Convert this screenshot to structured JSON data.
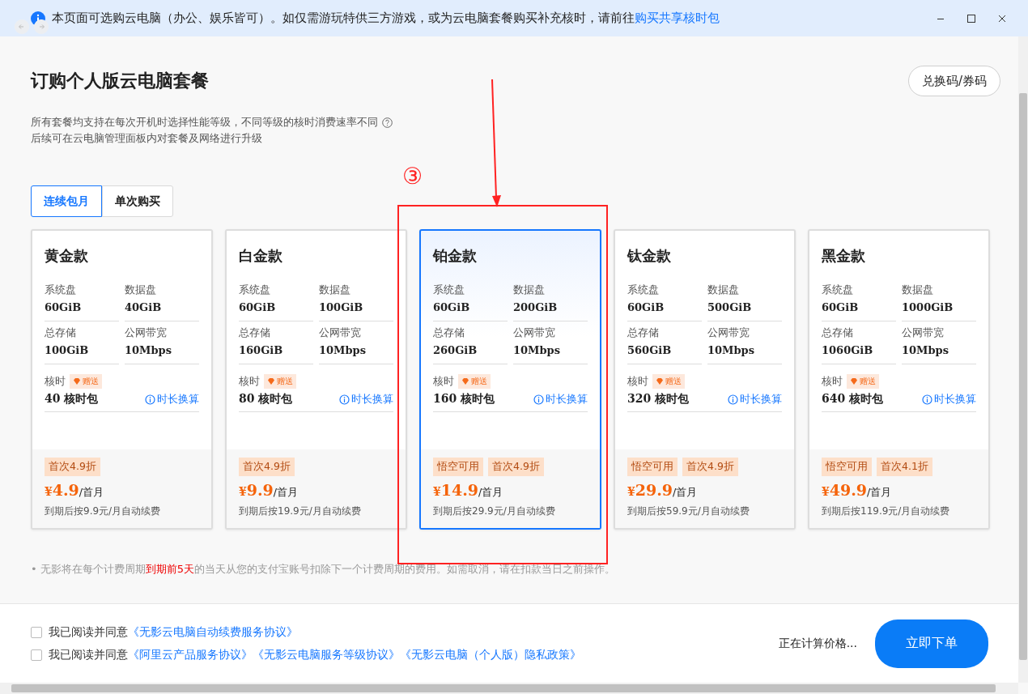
{
  "banner": {
    "text": "本页面可选购云电脑（办公、娱乐皆可）。如仅需游玩特供三方游戏，或为云电脑套餐购买补充核时，请前往",
    "link": "购买共享核时包"
  },
  "title": "订购个人版云电脑套餐",
  "redeem_button": "兑换码/券码",
  "notes": [
    "所有套餐均支持在每次开机时选择性能等级，不同等级的核时消费速率不同",
    "后续可在云电脑管理面板内对套餐及网络进行升级"
  ],
  "tabs": [
    {
      "label": "连续包月",
      "selected": true
    },
    {
      "label": "单次购买",
      "selected": false
    }
  ],
  "plans": [
    {
      "name": "黄金款",
      "selected": false,
      "specs": [
        {
          "label": "系统盘",
          "value": "60GiB"
        },
        {
          "label": "数据盘",
          "value": "40GiB"
        },
        {
          "label": "总存储",
          "value": "100GiB"
        },
        {
          "label": "公网带宽",
          "value": "10Mbps"
        }
      ],
      "core_label": "核时",
      "gift": "赠送",
      "core_value": "40 核时包",
      "convert": "时长换算",
      "tags": [
        "首次4.9折"
      ],
      "currency": "¥",
      "price": "4.9",
      "unit": "/首月",
      "renewal": "到期后按9.9元/月自动续费"
    },
    {
      "name": "白金款",
      "selected": false,
      "specs": [
        {
          "label": "系统盘",
          "value": "60GiB"
        },
        {
          "label": "数据盘",
          "value": "100GiB"
        },
        {
          "label": "总存储",
          "value": "160GiB"
        },
        {
          "label": "公网带宽",
          "value": "10Mbps"
        }
      ],
      "core_label": "核时",
      "gift": "赠送",
      "core_value": "80 核时包",
      "convert": "时长换算",
      "tags": [
        "首次4.9折"
      ],
      "currency": "¥",
      "price": "9.9",
      "unit": "/首月",
      "renewal": "到期后按19.9元/月自动续费"
    },
    {
      "name": "铂金款",
      "selected": true,
      "specs": [
        {
          "label": "系统盘",
          "value": "60GiB"
        },
        {
          "label": "数据盘",
          "value": "200GiB"
        },
        {
          "label": "总存储",
          "value": "260GiB"
        },
        {
          "label": "公网带宽",
          "value": "10Mbps"
        }
      ],
      "core_label": "核时",
      "gift": "赠送",
      "core_value": "160 核时包",
      "convert": "时长换算",
      "tags": [
        "悟空可用",
        "首次4.9折"
      ],
      "currency": "¥",
      "price": "14.9",
      "unit": "/首月",
      "renewal": "到期后按29.9元/月自动续费"
    },
    {
      "name": "钛金款",
      "selected": false,
      "specs": [
        {
          "label": "系统盘",
          "value": "60GiB"
        },
        {
          "label": "数据盘",
          "value": "500GiB"
        },
        {
          "label": "总存储",
          "value": "560GiB"
        },
        {
          "label": "公网带宽",
          "value": "10Mbps"
        }
      ],
      "core_label": "核时",
      "gift": "赠送",
      "core_value": "320 核时包",
      "convert": "时长换算",
      "tags": [
        "悟空可用",
        "首次4.9折"
      ],
      "currency": "¥",
      "price": "29.9",
      "unit": "/首月",
      "renewal": "到期后按59.9元/月自动续费"
    },
    {
      "name": "黑金款",
      "selected": false,
      "specs": [
        {
          "label": "系统盘",
          "value": "60GiB"
        },
        {
          "label": "数据盘",
          "value": "1000GiB"
        },
        {
          "label": "总存储",
          "value": "1060GiB"
        },
        {
          "label": "公网带宽",
          "value": "10Mbps"
        }
      ],
      "core_label": "核时",
      "gift": "赠送",
      "core_value": "640 核时包",
      "convert": "时长换算",
      "tags": [
        "悟空可用",
        "首次4.1折"
      ],
      "currency": "¥",
      "price": "49.9",
      "unit": "/首月",
      "renewal": "到期后按119.9元/月自动续费"
    }
  ],
  "disclaimer": {
    "bullet": "•",
    "before": "无影将在每个计费周期",
    "highlight": "到期前5天",
    "after": "的当天从您的支付宝账号扣除下一个计费周期的费用。如需取消，请在扣款当日之前操作。"
  },
  "agreements": [
    {
      "checked": false,
      "prefix": "我已阅读并同意",
      "links": [
        "《无影云电脑自动续费服务协议》"
      ]
    },
    {
      "checked": false,
      "prefix": "我已阅读并同意",
      "links": [
        "《阿里云产品服务协议》",
        "《无影云电脑服务等级协议》",
        "《无影云电脑（个人版）隐私政策》"
      ]
    }
  ],
  "status": "正在计算价格...",
  "order_button": "立即下单",
  "annotation": {
    "label": "③"
  }
}
